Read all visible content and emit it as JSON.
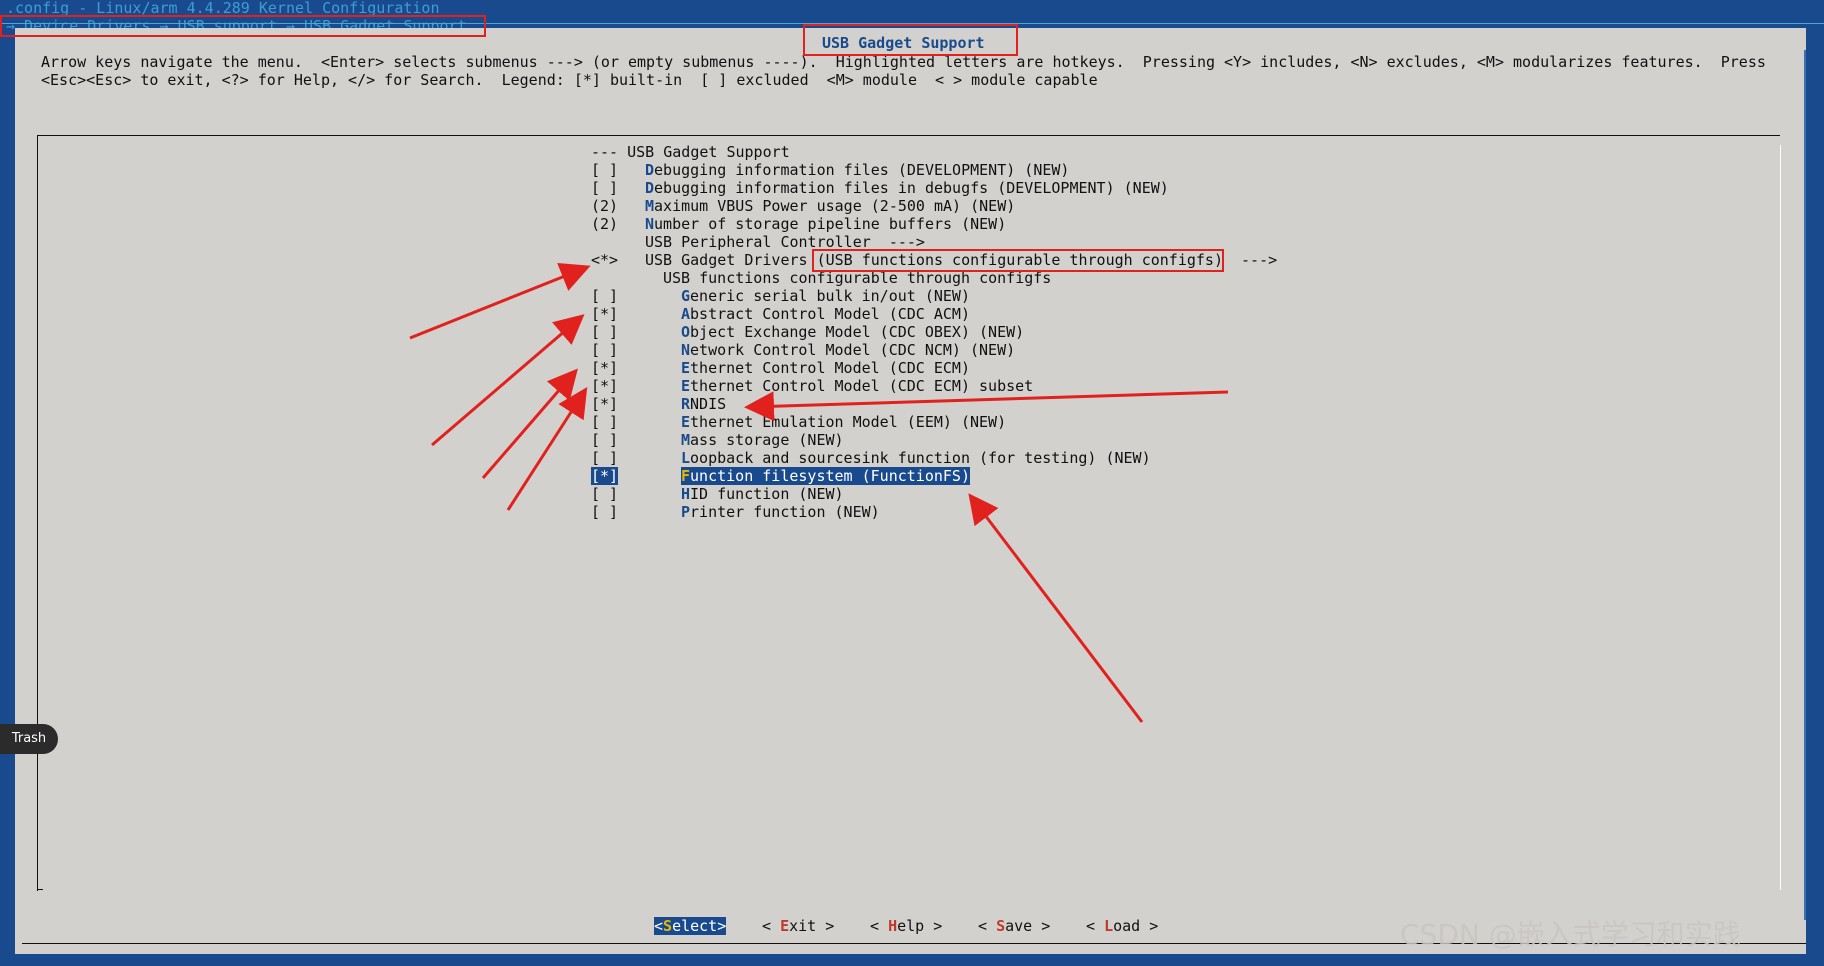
{
  "window": {
    "title": ".config - Linux/arm 4.4.289 Kernel Configuration",
    "breadcrumb": "→ Device Drivers → USB support → USB Gadget Support"
  },
  "panel": {
    "title": "USB Gadget Support",
    "help_line1": "Arrow keys navigate the menu.  <Enter> selects submenus ---> (or empty submenus ----).  Highlighted letters are hotkeys.  Pressing <Y> includes, <N> excludes, <M> modularizes features.  Press",
    "help_line2": "<Esc><Esc> to exit, <?> for Help, </> for Search.  Legend: [*] built-in  [ ] excluded  <M> module  < > module capable"
  },
  "menu": {
    "header": "--- USB Gadget Support",
    "items": [
      {
        "state": "[ ]",
        "hotkey": "D",
        "rest": "ebugging information files (DEVELOPMENT) (NEW)",
        "indent": 1
      },
      {
        "state": "[ ]",
        "hotkey": "D",
        "rest": "ebugging information files in debugfs (DEVELOPMENT) (NEW)",
        "indent": 1
      },
      {
        "state": "(2)",
        "hotkey": "M",
        "rest": "aximum VBUS Power usage (2-500 mA) (NEW)",
        "indent": 1
      },
      {
        "state": "(2)",
        "hotkey": "N",
        "rest": "umber of storage pipeline buffers (NEW)",
        "indent": 1
      },
      {
        "state": "",
        "hotkey": "",
        "rest": "USB Peripheral Controller  --->",
        "indent": 1
      },
      {
        "state": "<*>",
        "hotkey": "",
        "rest": "USB Gadget Drivers (USB functions configurable through configfs)  --->",
        "indent": 1
      },
      {
        "state": "",
        "hotkey": "",
        "rest": "USB functions configurable through configfs",
        "indent": 2
      },
      {
        "state": "[ ]",
        "hotkey": "G",
        "rest": "eneric serial bulk in/out (NEW)",
        "indent": 3
      },
      {
        "state": "[*]",
        "hotkey": "A",
        "rest": "bstract Control Model (CDC ACM)",
        "indent": 3
      },
      {
        "state": "[ ]",
        "hotkey": "O",
        "rest": "bject Exchange Model (CDC OBEX) (NEW)",
        "indent": 3
      },
      {
        "state": "[ ]",
        "hotkey": "N",
        "rest": "etwork Control Model (CDC NCM) (NEW)",
        "indent": 3
      },
      {
        "state": "[*]",
        "hotkey": "E",
        "rest": "thernet Control Model (CDC ECM)",
        "indent": 3
      },
      {
        "state": "[*]",
        "hotkey": "E",
        "rest": "thernet Control Model (CDC ECM) subset",
        "indent": 3
      },
      {
        "state": "[*]",
        "hotkey": "R",
        "rest": "NDIS",
        "indent": 3
      },
      {
        "state": "[ ]",
        "hotkey": "E",
        "rest": "thernet Emulation Model (EEM) (NEW)",
        "indent": 3
      },
      {
        "state": "[ ]",
        "hotkey": "M",
        "rest": "ass storage (NEW)",
        "indent": 3
      },
      {
        "state": "[ ]",
        "hotkey": "L",
        "rest": "oopback and sourcesink function (for testing) (NEW)",
        "indent": 3
      },
      {
        "state": "[*]",
        "hotkey": "F",
        "rest": "unction filesystem (FunctionFS)",
        "indent": 3,
        "selected": true
      },
      {
        "state": "[ ]",
        "hotkey": "H",
        "rest": "ID function (NEW)",
        "indent": 3
      },
      {
        "state": "[ ]",
        "hotkey": "P",
        "rest": "rinter function (NEW)",
        "indent": 3
      }
    ]
  },
  "buttons": [
    {
      "pre": "<",
      "hotkey": "S",
      "rest": "elect>",
      "active": true
    },
    {
      "pre": "< ",
      "hotkey": "E",
      "rest": "xit >",
      "active": false
    },
    {
      "pre": "< ",
      "hotkey": "H",
      "rest": "elp >",
      "active": false
    },
    {
      "pre": "< ",
      "hotkey": "S",
      "rest": "ave >",
      "active": false
    },
    {
      "pre": "< ",
      "hotkey": "L",
      "rest": "oad >",
      "active": false
    }
  ],
  "dock": {
    "trash_label": "Trash"
  },
  "watermark": "CSDN @嵌入式学习和实践",
  "colors": {
    "background": "#1a4a8e",
    "panel": "#d3d1cd",
    "hotkey": "#1a4a8e",
    "button_hotkey": "#c0392b",
    "annotation": "#e0211d"
  }
}
